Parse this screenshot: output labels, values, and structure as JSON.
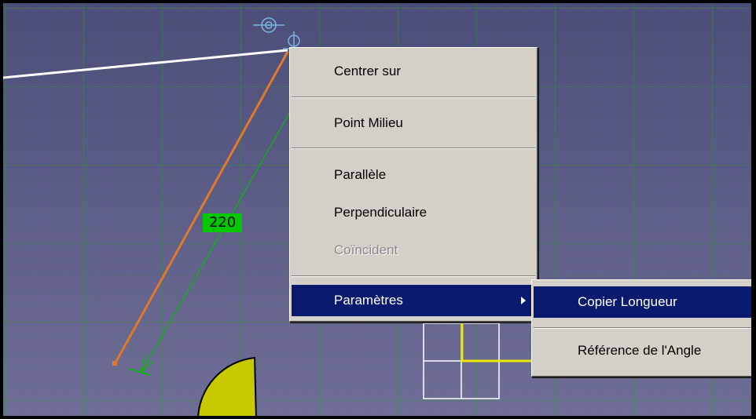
{
  "dimension_value": "220",
  "context_menu": {
    "items": [
      {
        "label": "Centrer sur"
      },
      {
        "label": "Point Milieu"
      },
      {
        "label": "Parallèle"
      },
      {
        "label": "Perpendiculaire"
      },
      {
        "label": "Coïncident",
        "enabled": false
      },
      {
        "label": "Paramètres",
        "highlighted": true,
        "has_submenu": true
      }
    ]
  },
  "submenu": {
    "items": [
      {
        "label": "Copier Longueur",
        "highlighted": true
      },
      {
        "label": "Référence de l'Angle"
      }
    ]
  },
  "colors": {
    "background": "#4d4d7a",
    "grid": "#3f8a3f",
    "highlight": "#0a1a6e",
    "menu_face": "#d4d0c8",
    "sketch_line": "#e07a2a",
    "dimension_line": "#00c000",
    "circle_fill": "#c8c800"
  },
  "icons": [
    "point-constraint-icon",
    "submenu-arrow-icon"
  ]
}
